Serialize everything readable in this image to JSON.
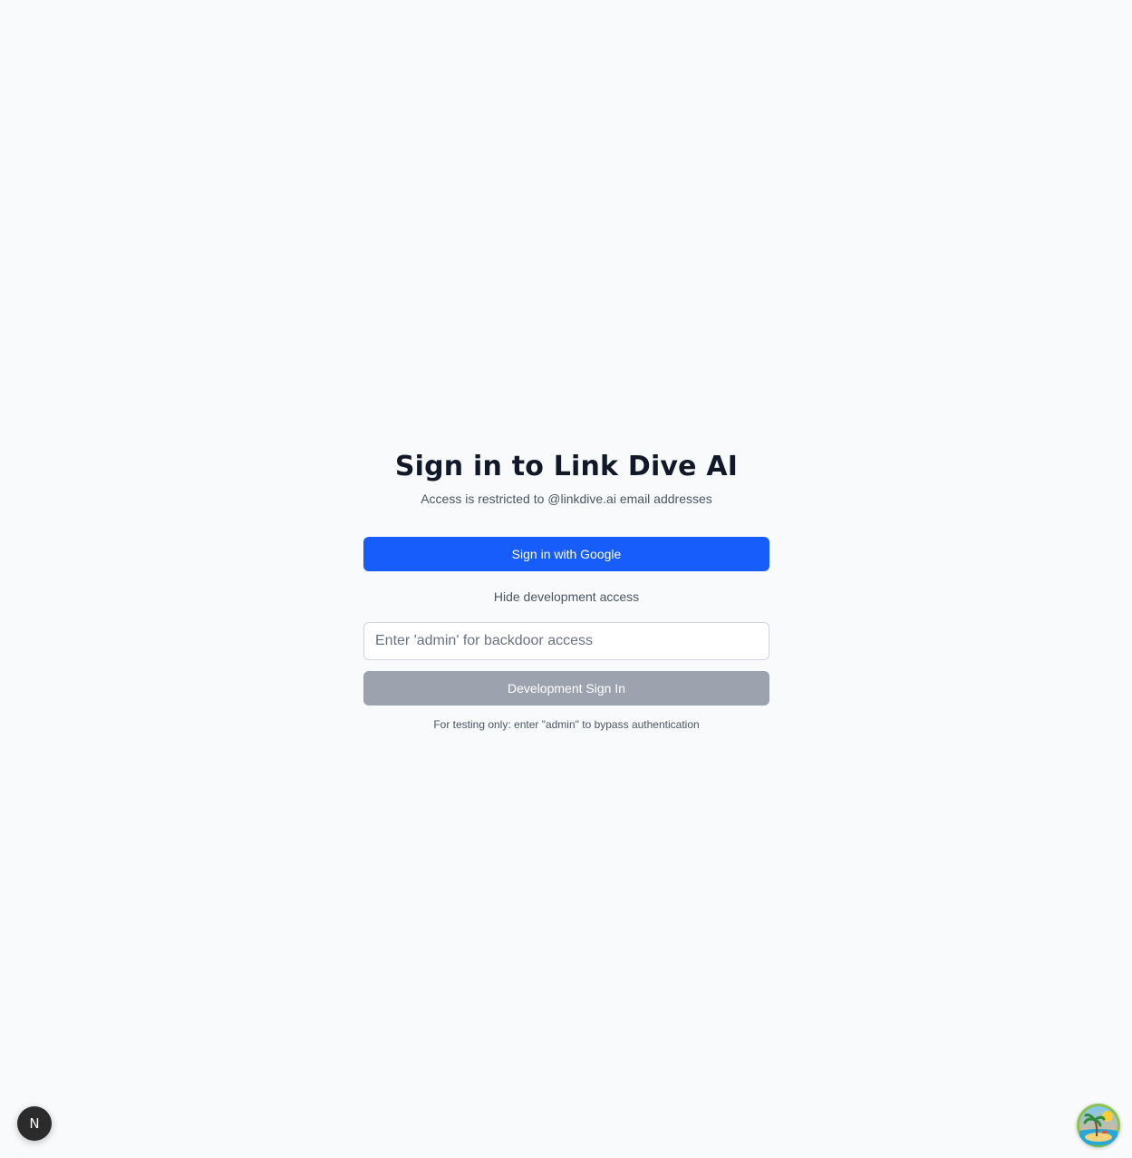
{
  "auth": {
    "title": "Sign in to Link Dive AI",
    "subtitle": "Access is restricted to @linkdive.ai email addresses",
    "google_button_label": "Sign in with Google",
    "dev_toggle_label": "Hide development access",
    "dev_input": {
      "value": "",
      "placeholder": "Enter 'admin' for backdoor access"
    },
    "dev_button_label": "Development Sign In",
    "dev_note": "For testing only: enter \"admin\" to bypass authentication"
  },
  "floating": {
    "nextjs_badge_letter": "N",
    "nextjs_badge_icon": "nextjs-logo-icon",
    "extension_icon": "island-avatar-icon"
  },
  "colors": {
    "background": "#f8fafc",
    "primary": "#165dfb",
    "disabled": "#9ca3af",
    "title": "#111827",
    "muted_text": "#4b5563"
  }
}
